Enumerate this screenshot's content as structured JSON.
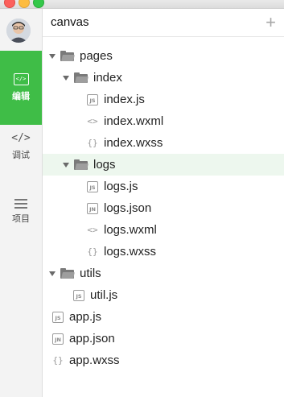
{
  "sidebar": {
    "nav": [
      {
        "label": "编辑",
        "icon": "code-box-icon",
        "active": true
      },
      {
        "label": "调试",
        "icon": "code-brackets-icon",
        "active": false
      },
      {
        "label": "项目",
        "icon": "menu-lines-icon",
        "active": false
      }
    ],
    "code_icon_glyph": "</>"
  },
  "explorer": {
    "title": "canvas",
    "add_glyph": "+",
    "tree": [
      {
        "name": "pages",
        "type": "folder",
        "expanded": true,
        "depth": 0
      },
      {
        "name": "index",
        "type": "folder",
        "expanded": true,
        "depth": 1
      },
      {
        "name": "index.js",
        "type": "file",
        "icon": "JS",
        "depth": 2
      },
      {
        "name": "index.wxml",
        "type": "file",
        "icon": "<>",
        "depth": 2
      },
      {
        "name": "index.wxss",
        "type": "file",
        "icon": "{}",
        "depth": 2
      },
      {
        "name": "logs",
        "type": "folder",
        "expanded": true,
        "depth": 1,
        "selected": true
      },
      {
        "name": "logs.js",
        "type": "file",
        "icon": "JS",
        "depth": 2
      },
      {
        "name": "logs.json",
        "type": "file",
        "icon": "JN",
        "depth": 2
      },
      {
        "name": "logs.wxml",
        "type": "file",
        "icon": "<>",
        "depth": 2
      },
      {
        "name": "logs.wxss",
        "type": "file",
        "icon": "{}",
        "depth": 2
      },
      {
        "name": "utils",
        "type": "folder",
        "expanded": true,
        "depth": 0
      },
      {
        "name": "util.js",
        "type": "file",
        "icon": "JS",
        "depth": 1
      },
      {
        "name": "app.js",
        "type": "file",
        "icon": "JS",
        "depth": 0
      },
      {
        "name": "app.json",
        "type": "file",
        "icon": "JN",
        "depth": 0
      },
      {
        "name": "app.wxss",
        "type": "file",
        "icon": "{}",
        "depth": 0
      }
    ]
  },
  "colors": {
    "accent": "#3fbd47",
    "selected_row": "#edf7ee"
  }
}
